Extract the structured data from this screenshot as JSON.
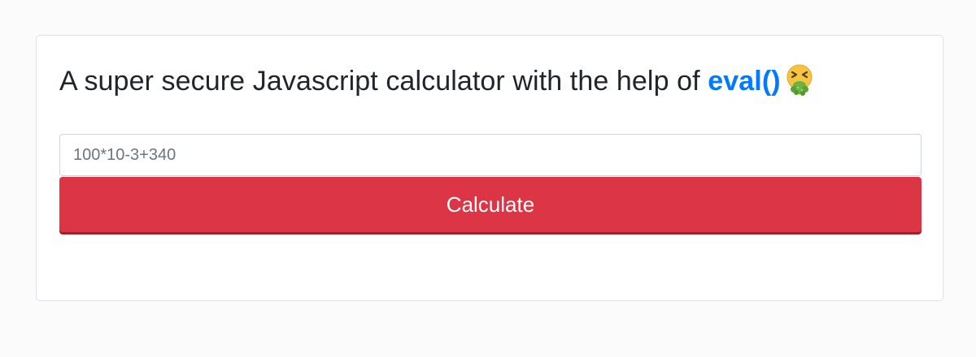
{
  "calculator": {
    "title_prefix": "A super secure Javascript calculator with the help of",
    "title_accent": "eval()",
    "title_icon": "nauseated-face-emoji-icon",
    "input_value": "100*10-3+340",
    "button_label": "Calculate"
  },
  "colors": {
    "accent": "#007bff",
    "button": "#dc3545",
    "page_background": "#fbfbfb"
  }
}
